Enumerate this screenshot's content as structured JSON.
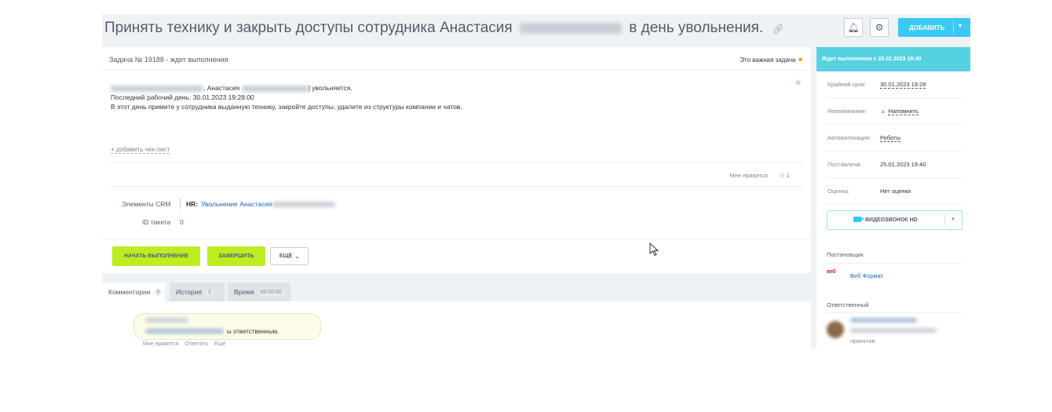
{
  "header": {
    "title_part1": "Принять технику и закрыть доступы сотрудника Анастасия",
    "title_part2": "в день увольнения.",
    "add_label": "ДОБАВИТЬ"
  },
  "task": {
    "number_status": "Задача № 19188 - ждет выполнения",
    "important_label": "Это важная задача",
    "desc_line1_suffix": ", Анастасия",
    "desc_line1_end": "] увольняется.",
    "desc_line2": "Последний рабочий день: 30.01.2023 19:28:00",
    "desc_line3": "В этот  день примите  у сотрудника выданную технику, закройте доступы, удалите из структуры компании и чатов.",
    "add_checklist": "+ добавить чек-лист",
    "likes_label": "Мне нравится",
    "likes_count": "1",
    "crm_label": "Элементы CRM",
    "crm_hr": "HR:",
    "crm_value": "Увольнение Анастасия",
    "ticket_label": "ID тикета",
    "ticket_value": "0",
    "btn_start": "НАЧАТЬ ВЫПОЛНЕНИЕ",
    "btn_finish": "ЗАВЕРШИТЬ",
    "btn_more": "ЕЩЁ"
  },
  "tabs": [
    {
      "label": "Комментарии",
      "badge": "0"
    },
    {
      "label": "История",
      "badge": "2"
    },
    {
      "label": "Время",
      "badge": "00:00:00"
    }
  ],
  "comment": {
    "text_tail": "ы ответственным.",
    "actions": [
      "Мне нравится",
      "Ответить",
      "Ещё"
    ]
  },
  "sidebar": {
    "status": "Ждет выполнения с 25.01.2023 19:40",
    "rows": [
      {
        "key": "Крайний срок:",
        "value": "30.01.2023 19:28"
      },
      {
        "key": "Напоминание:",
        "value": "Напомнить"
      },
      {
        "key": "Автоматизация:",
        "value": "Роботы"
      },
      {
        "key": "Поставлена:",
        "value": "25.01.2023 19:40"
      },
      {
        "key": "Оценка:",
        "value": "Нет оценки"
      }
    ],
    "video_label": "ВИДЕОЗВОНОК HD",
    "creator_label": "Постановщик",
    "creator_logo": "веб",
    "creator_name": "Веб Формат",
    "responsible_label": "Ответственный",
    "responsible_sub": "проектов"
  },
  "colors": {
    "accent_blue": "#3bc8f5",
    "status_teal": "#56d1e0",
    "button_green": "#bbed21",
    "link_blue": "#2067b0"
  }
}
